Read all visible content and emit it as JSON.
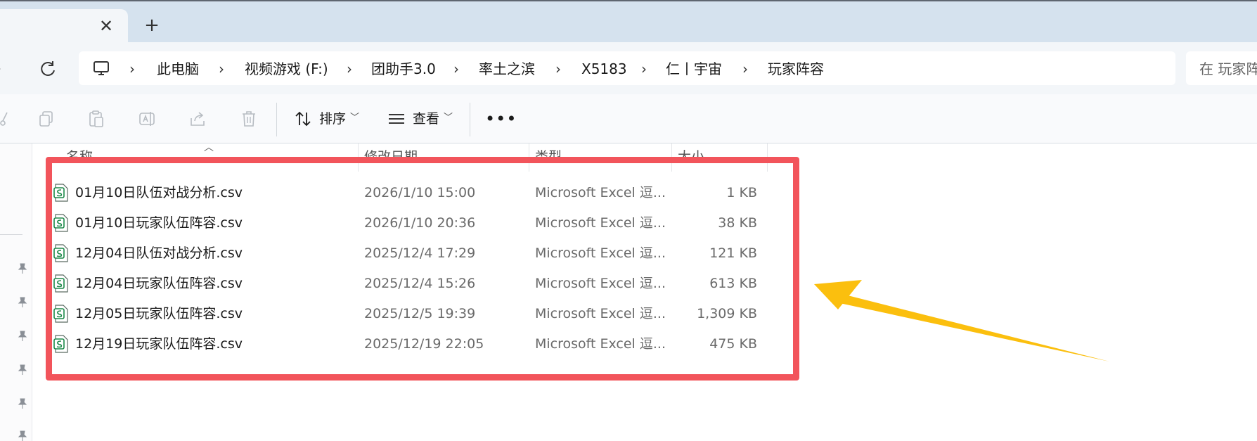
{
  "tab": {
    "close_icon": "close-icon",
    "add_icon": "plus-icon"
  },
  "nav": {
    "refresh_icon": "refresh-icon",
    "breadcrumb": [
      "此电脑",
      "视频游戏 (F:)",
      "团助手3.0",
      "率土之滨",
      "X5183",
      "仁丨宇宙",
      "玩家阵容"
    ],
    "separator": "›",
    "search_placeholder": "在 玩家阵"
  },
  "toolbar": {
    "sort_label": "排序",
    "view_label": "查看",
    "more_label": "•••"
  },
  "columns": {
    "name": "名称",
    "modified": "修改日期",
    "type": "类型",
    "size": "大小"
  },
  "files": [
    {
      "name": "01月10日队伍对战分析.csv",
      "modified": "2026/1/10 15:00",
      "type": "Microsoft Excel 逗...",
      "size": "1 KB"
    },
    {
      "name": "01月10日玩家队伍阵容.csv",
      "modified": "2026/1/10 20:36",
      "type": "Microsoft Excel 逗...",
      "size": "38 KB"
    },
    {
      "name": "12月04日队伍对战分析.csv",
      "modified": "2025/12/4 17:29",
      "type": "Microsoft Excel 逗...",
      "size": "121 KB"
    },
    {
      "name": "12月04日玩家队伍阵容.csv",
      "modified": "2025/12/4 15:26",
      "type": "Microsoft Excel 逗...",
      "size": "613 KB"
    },
    {
      "name": "12月05日玩家队伍阵容.csv",
      "modified": "2025/12/5 19:39",
      "type": "Microsoft Excel 逗...",
      "size": "1,309 KB"
    },
    {
      "name": "12月19日玩家队伍阵容.csv",
      "modified": "2025/12/19 22:05",
      "type": "Microsoft Excel 逗...",
      "size": "475 KB"
    }
  ],
  "colors": {
    "highlight_box": "#f2545b",
    "arrow": "#fbbf0e",
    "csv_icon": "#1d8a4a"
  }
}
